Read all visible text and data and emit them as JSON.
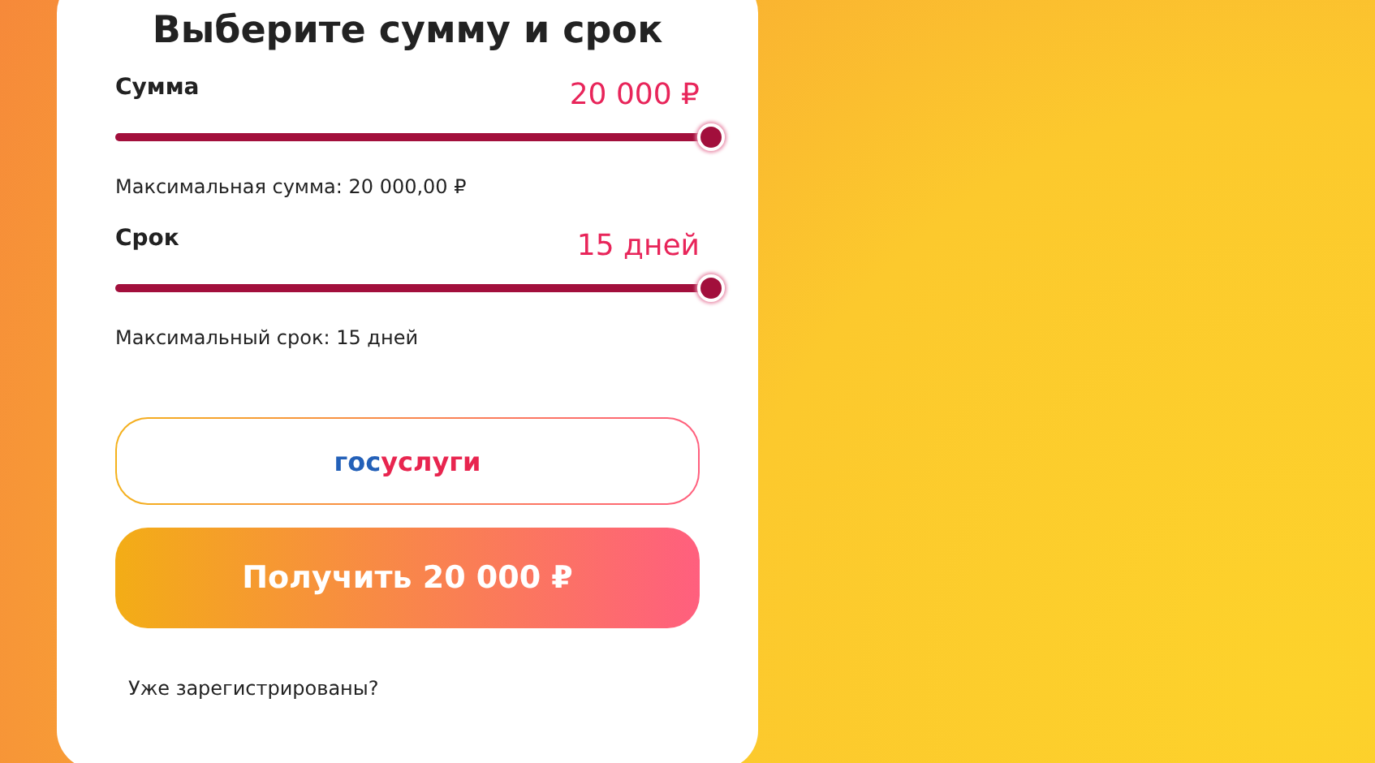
{
  "title": "Выберите сумму и срок",
  "sliders": [
    {
      "label": "Сумма",
      "reading": "20 000 ₽",
      "level": 1,
      "note": "Максимальная сумма: 20 000,00 ₽"
    },
    {
      "label": "Срок",
      "reading": "15 дней",
      "level": 1,
      "note": "Максимальный срок: 15 дней"
    }
  ],
  "gosuslugi_button": {
    "parts": [
      {
        "text": "гос",
        "color": "#2360b8"
      },
      {
        "text": "услуги",
        "color": "#e8254f"
      }
    ]
  },
  "submit_button": {
    "label": "Получить 20 000 ₽"
  },
  "login_prompt": "Уже зарегистрированы?"
}
